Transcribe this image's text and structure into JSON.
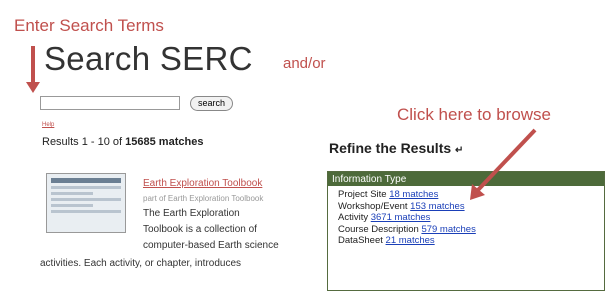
{
  "annotations": {
    "enter_search_terms": "Enter Search Terms",
    "and_or": "and/or",
    "click_to_browse": "Click here to browse"
  },
  "page_title": "Search SERC",
  "search": {
    "input_value": "",
    "button_label": "search",
    "help_label": "Help"
  },
  "results_summary": {
    "prefix": "Results 1 - 10 of ",
    "total": "15685 matches"
  },
  "results": [
    {
      "title": "Earth Exploration Toolbook",
      "subtitle": "part of Earth Exploration Toolbook",
      "description_lines": [
        "The Earth Exploration",
        "Toolbook is a collection of",
        "computer-based Earth science",
        "activities. Each activity, or chapter, introduces"
      ]
    }
  ],
  "refine": {
    "heading": "Refine the Results",
    "group_title": "Information Type",
    "items": [
      {
        "label": "Project Site",
        "link": "18 matches"
      },
      {
        "label": "Workshop/Event",
        "link": "153 matches"
      },
      {
        "label": "Activity",
        "link": "3671 matches"
      },
      {
        "label": "Course Description",
        "link": "579 matches"
      },
      {
        "label": "DataSheet",
        "link": "21 matches"
      }
    ]
  },
  "colors": {
    "annotation": "#c0504d",
    "panel_header": "#4d6a3a",
    "link": "#1a3fb8"
  }
}
